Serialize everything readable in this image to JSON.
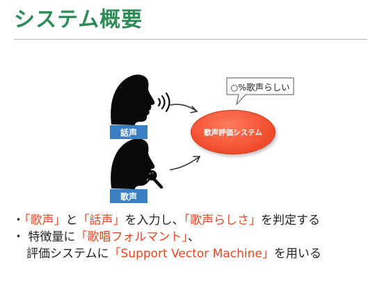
{
  "slide": {
    "title": "システム概要"
  },
  "diagram": {
    "speech_label": "話声",
    "singing_label": "歌声",
    "system_label": "歌声評価システム",
    "callout_text": "○%歌声らしい"
  },
  "bullets": [
    {
      "parts": [
        {
          "text": "・",
          "hl": false
        },
        {
          "text": "「歌声」",
          "hl": true
        },
        {
          "text": "と",
          "hl": false
        },
        {
          "text": "「話声」",
          "hl": true
        },
        {
          "text": "を入力し、",
          "hl": false
        },
        {
          "text": "「歌声らしさ」",
          "hl": true
        },
        {
          "text": "を判定する",
          "hl": false
        }
      ]
    },
    {
      "parts": [
        {
          "text": "・ 特徴量に",
          "hl": false
        },
        {
          "text": "「歌唱フォルマント」",
          "hl": true
        },
        {
          "text": "、",
          "hl": false
        }
      ]
    },
    {
      "parts": [
        {
          "text": "評価システムに",
          "hl": false
        },
        {
          "text": "「Support Vector Machine」",
          "hl": true
        },
        {
          "text": "を用いる",
          "hl": false
        }
      ]
    }
  ],
  "colors": {
    "title": "#2e8b57",
    "highlight": "#e8461e",
    "label_box": "#3a7fc1",
    "oval": "#f04b2b"
  }
}
